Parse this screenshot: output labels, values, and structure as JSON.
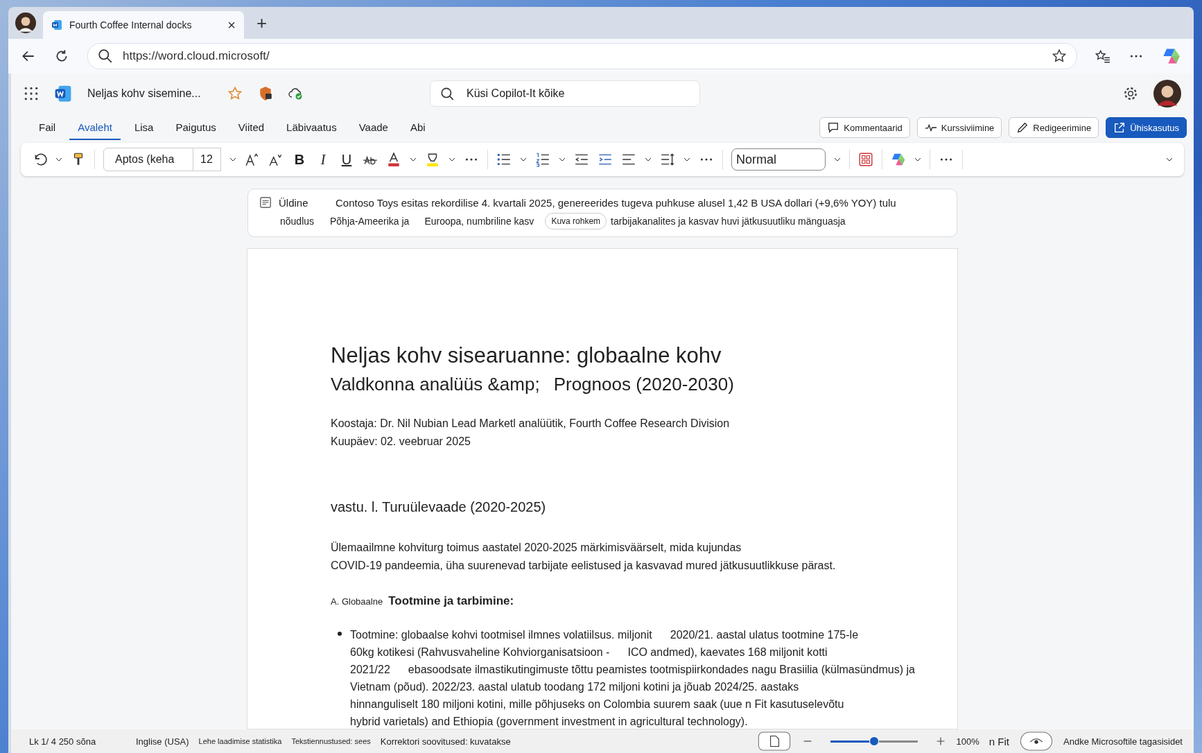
{
  "browser": {
    "tabs": [
      {
        "title": "Fourth Coffee Internal docks",
        "selected": true,
        "close": "×"
      }
    ],
    "new_tab": "+",
    "url": "https://word.cloud.microsoft/"
  },
  "app": {
    "doc_title": "Neljas kohv sisemine...",
    "search": {
      "placeholder": "Küsi Copilot-It kõike"
    }
  },
  "menu_tabs": [
    {
      "label": "Fail",
      "selected": false
    },
    {
      "label": "Avaleht",
      "selected": true
    },
    {
      "label": "Lisa",
      "selected": false
    },
    {
      "label": "Paigutus",
      "selected": false
    },
    {
      "label": "Viited",
      "selected": false
    },
    {
      "label": "Läbivaatus",
      "selected": false
    },
    {
      "label": "Vaade",
      "selected": false
    },
    {
      "label": "Abi",
      "selected": false
    }
  ],
  "actions": [
    {
      "label": "Kommentaarid",
      "kind": "comment"
    },
    {
      "label": "Kurssiviimine",
      "kind": "catchup"
    },
    {
      "label": "Redigeerimine",
      "kind": "edit"
    },
    {
      "label": "Ühiskasutus",
      "kind": "share"
    }
  ],
  "ribbon": {
    "font": "Aptos (keha",
    "size": "12",
    "glyphs": [
      "B",
      "I",
      "U"
    ],
    "style": "Normal"
  },
  "summary": {
    "label": "Üldine",
    "line1": "Contoso Toys esitas rekordilise 4. kvartali 2025, genereerides tugeva puhkuse alusel 1,42 B USA dollari (+9,6% YOY) tulu",
    "line2": [
      "nõudlus",
      "Põhja-Ameerika ja",
      "Euroopa, numbriline kasv"
    ],
    "more": "Kuva rohkem",
    "line2_end": "tarbijakanalites ja kasvav huvi jätkusuutliku mänguasja"
  },
  "document": {
    "title": "Neljas kohv sisearuanne: globaalne kohv",
    "subtitle": [
      "Valdkonna analüüs &amp;",
      "Prognoos (2020-2030)"
    ],
    "meta": [
      "Koostaja: Dr. Nil Nubian Lead Marketl analüütik, Fourth Coffee Research Division",
      "Kuupäev: 02. veebruar 2025"
    ],
    "heading": "vastu. l. Turuülevaade (2020-2025)",
    "paragraph": [
      "Ülemaailmne kohviturg toimus aastatel 2020-2025 märkimisväärselt, mida kujundas",
      "COVID-19 pandeemia, üha suurenevad tarbijate eelistused ja kasvavad mured jätkusuutlikkuse pärast."
    ],
    "subheading": {
      "prefix": "A. Globaalne",
      "text": "Tootmine ja tarbimine:"
    },
    "bullet_lines": [
      [
        "Tootmine: globaalse kohvi tootmisel ilmnes volatiilsus. miljonit",
        "2020/21. aastal ulatus tootmine 175-le"
      ],
      [
        "60kg kotikesi (Rahvusvaheline Kohviorganisatsioon -",
        "ICO andmed), kaevates 168 miljonit kotti"
      ],
      [
        "2021/22",
        "ebasoodsate ilmastikutingimuste tõttu peamistes tootmispiirkondades nagu Brasiilia (külmasündmus) ja"
      ],
      [
        "Vietnam (põud). 2022/23. aastal ulatub toodang 172 miljoni kotini ja jõuab 2024/25. aastaks"
      ],
      [
        "hinnanguliselt 180 miljoni kotini, mille põhjuseks on Colombia suurem saak (uue n Fit kasutuselevõtu"
      ],
      [
        "hybrid varietals) and Ethiopia (government investment in agricultural technology)."
      ]
    ]
  },
  "status_bar": {
    "items": [
      "Lk 1/ 4 250 sõna",
      "Inglise (USA)",
      "Lehe laadimise statistika",
      "Tekstiennustused: sees",
      "Korrektori soovitused: kuvatakse"
    ],
    "zoom": {
      "level": 0.5,
      "reading": "100%"
    },
    "fit": "n Fit",
    "feedback": "Andke Microsoftile tagasisidet"
  }
}
